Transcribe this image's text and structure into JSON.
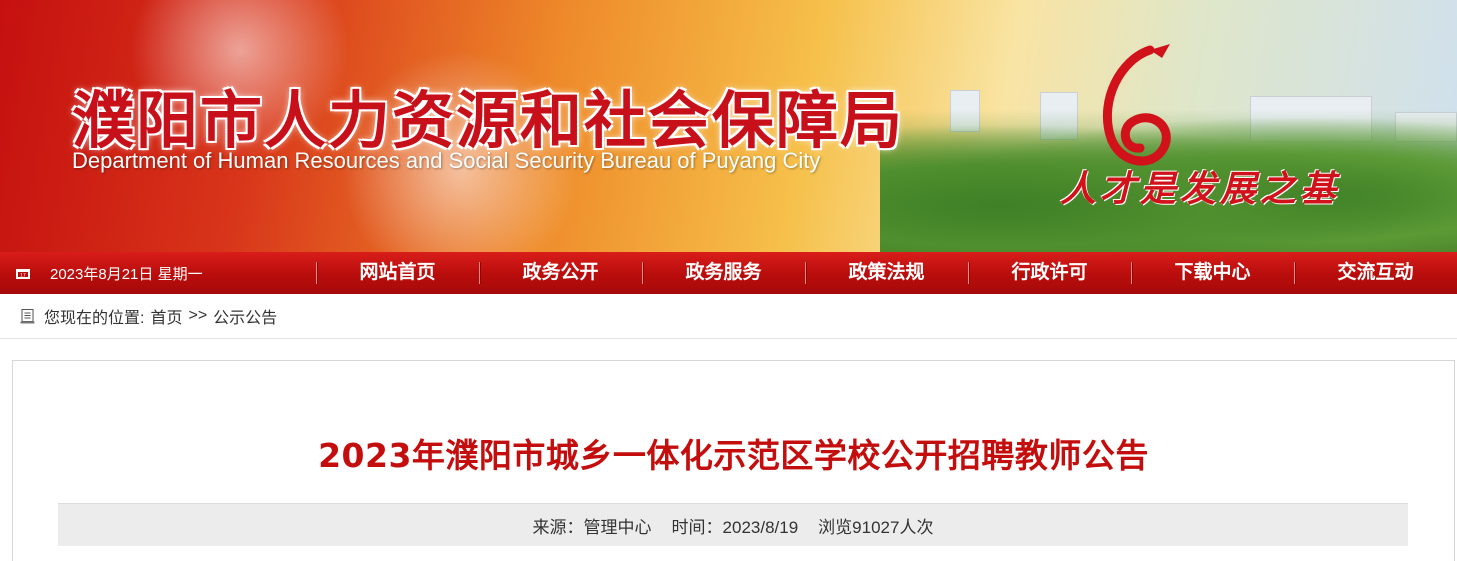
{
  "banner": {
    "title": "濮阳市人力资源和社会保障局",
    "subtitle": "Department of Human  Resources and Social Security Bureau of Puyang City",
    "slogan": "人才是发展之基"
  },
  "navbar": {
    "date": "2023年8月21日 星期一",
    "items": [
      "网站首页",
      "政务公开",
      "政务服务",
      "政策法规",
      "行政许可",
      "下载中心",
      "交流互动"
    ]
  },
  "breadcrumb": {
    "prefix": "您现在的位置:",
    "home": "首页",
    "separator": ">>",
    "current": "公示公告"
  },
  "article": {
    "title": "2023年濮阳市城乡一体化示范区学校公开招聘教师公告",
    "source_label": "来源：管理中心",
    "time_label": "时间：2023/8/19",
    "views_label": "浏览91027人次"
  },
  "colors": {
    "nav_red": "#b80d0c",
    "title_red": "#c40d0d",
    "banner_title_red": "#c8101a"
  }
}
